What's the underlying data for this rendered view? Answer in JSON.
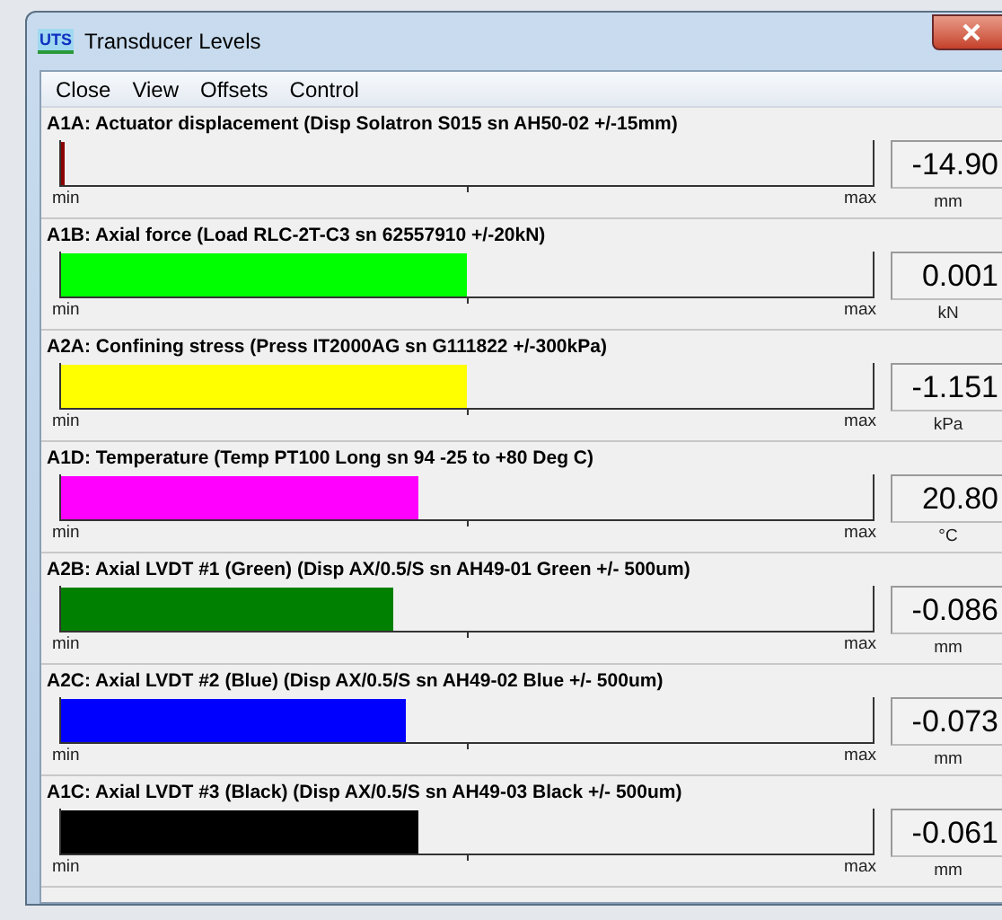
{
  "window": {
    "title": "Transducer Levels",
    "icon_label": "UTS"
  },
  "menu": [
    "Close",
    "View",
    "Offsets",
    "Control"
  ],
  "channels": [
    {
      "label": "A1A:  Actuator displacement (Disp Solatron S015 sn AH50-02  +/-15mm)",
      "level": 0.003,
      "color": "#8b0000",
      "min": "min",
      "max": "max",
      "reading": "-14.90",
      "unit": "mm"
    },
    {
      "label": "A1B:  Axial force (Load RLC-2T-C3 sn 62557910 +/-20kN)",
      "level": 0.5,
      "color": "#00ff00",
      "min": "min",
      "max": "max",
      "reading": "0.001",
      "unit": "kN"
    },
    {
      "label": "A2A:  Confining stress (Press IT2000AG sn G111822 +/-300kPa)",
      "level": 0.5,
      "color": "#ffff00",
      "min": "min",
      "max": "max",
      "reading": "-1.151",
      "unit": "kPa"
    },
    {
      "label": "A1D:  Temperature (Temp PT100 Long sn 94 -25 to +80 Deg C)",
      "level": 0.44,
      "color": "#ff00ff",
      "min": "min",
      "max": "max",
      "reading": "20.80",
      "unit": "°C"
    },
    {
      "label": "A2B:  Axial LVDT #1 (Green) (Disp AX/0.5/S sn AH49-01 Green +/- 500um)",
      "level": 0.41,
      "color": "#008000",
      "min": "min",
      "max": "max",
      "reading": "-0.086",
      "unit": "mm"
    },
    {
      "label": "A2C:  Axial LVDT #2 (Blue) (Disp AX/0.5/S sn AH49-02 Blue +/- 500um)",
      "level": 0.425,
      "color": "#0000ff",
      "min": "min",
      "max": "max",
      "reading": "-0.073",
      "unit": "mm"
    },
    {
      "label": "A1C:  Axial LVDT #3 (Black) (Disp AX/0.5/S sn AH49-03 Black +/- 500um)",
      "level": 0.44,
      "color": "#000000",
      "min": "min",
      "max": "max",
      "reading": "-0.061",
      "unit": "mm"
    }
  ]
}
